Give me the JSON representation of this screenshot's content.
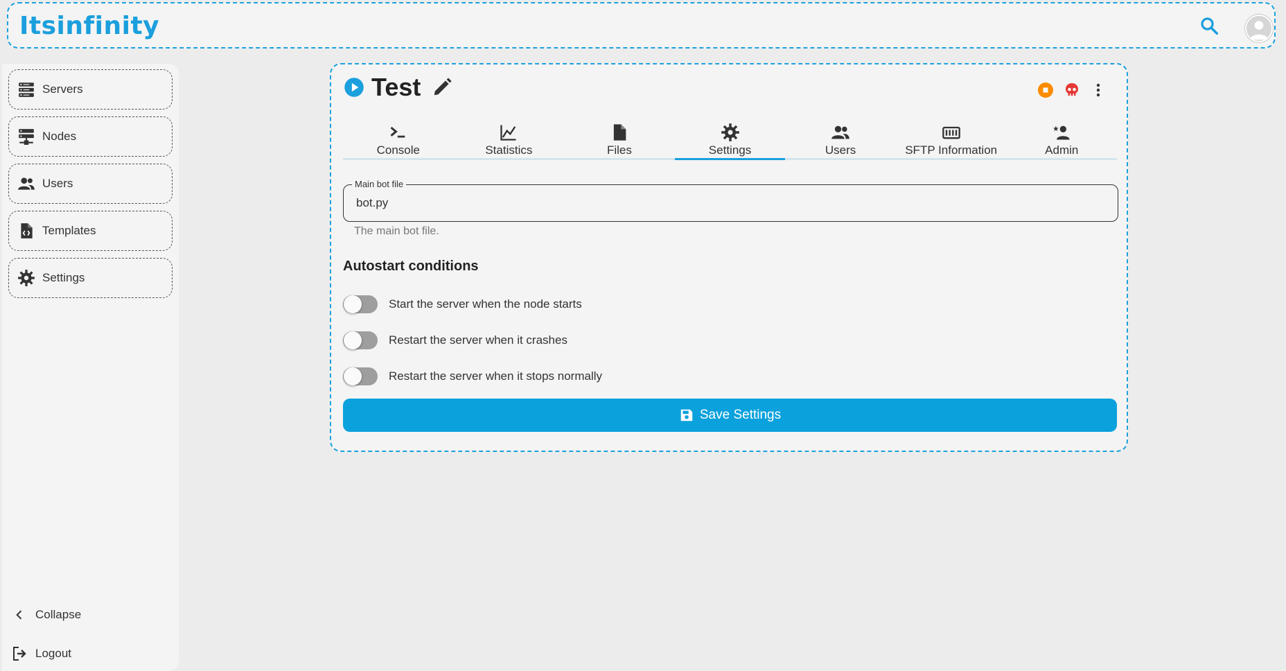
{
  "colors": {
    "brand": "#1b9fdd",
    "danger": "#e53935",
    "warning": "#fb8c00",
    "toggle_off": "#9e9e9e"
  },
  "header": {
    "logo_text": "Itsinfinity",
    "search_icon": "search-icon",
    "avatar_icon": "user-avatar-icon"
  },
  "sidebar": {
    "items": [
      {
        "label": "Servers",
        "icon": "servers-icon"
      },
      {
        "label": "Nodes",
        "icon": "nodes-icon"
      },
      {
        "label": "Users",
        "icon": "users-icon"
      },
      {
        "label": "Templates",
        "icon": "template-file-icon"
      },
      {
        "label": "Settings",
        "icon": "gear-icon"
      }
    ],
    "collapse_label": "Collapse",
    "logout_label": "Logout"
  },
  "server": {
    "title": "Test",
    "status_icon": "play-circle-icon",
    "edit_icon": "pencil-icon",
    "controls": [
      "stop-icon",
      "kill-skull-icon",
      "more-vertical-icon"
    ]
  },
  "tabs": [
    {
      "label": "Console",
      "icon": "terminal-icon"
    },
    {
      "label": "Statistics",
      "icon": "chart-line-icon"
    },
    {
      "label": "Files",
      "icon": "file-icon"
    },
    {
      "label": "Settings",
      "icon": "gear-icon",
      "active": true
    },
    {
      "label": "Users",
      "icon": "users-icon"
    },
    {
      "label": "SFTP Information",
      "icon": "sftp-icon"
    },
    {
      "label": "Admin",
      "icon": "admin-user-icon"
    }
  ],
  "settings": {
    "main_bot_file": {
      "label": "Main bot file",
      "value": "bot.py",
      "helper": "The main bot file."
    },
    "autostart_title": "Autostart conditions",
    "toggles": [
      {
        "label": "Start the server when the node starts",
        "on": false
      },
      {
        "label": "Restart the server when it crashes",
        "on": false
      },
      {
        "label": "Restart the server when it stops normally",
        "on": false
      }
    ],
    "save_label": "Save Settings"
  }
}
